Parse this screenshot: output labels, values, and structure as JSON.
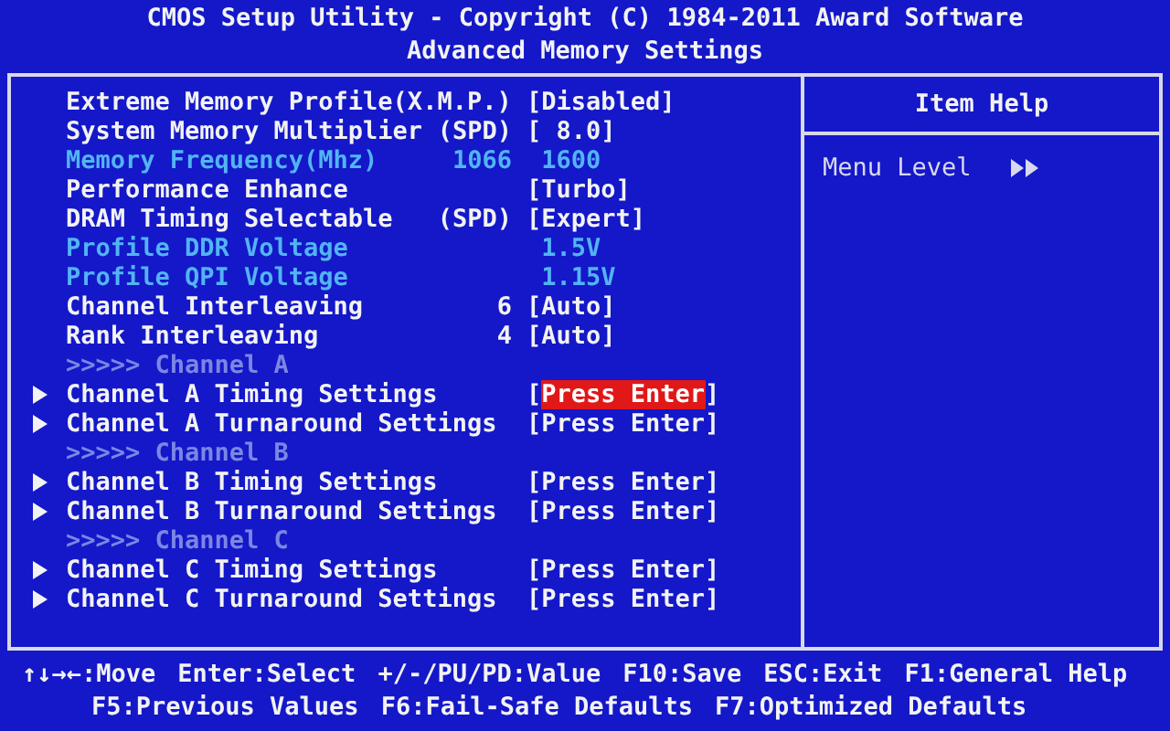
{
  "header": {
    "title": "CMOS Setup Utility - Copyright (C) 1984-2011 Award Software",
    "subtitle": "Advanced Memory Settings"
  },
  "items": [
    {
      "kind": "setting",
      "label": "Extreme Memory Profile(X.M.P.)",
      "value": "[Disabled]",
      "disabled": false,
      "selected": false
    },
    {
      "kind": "setting",
      "label": "System Memory Multiplier",
      "mid": "(SPD)",
      "value": "[ 8.0]",
      "disabled": false,
      "selected": false
    },
    {
      "kind": "setting",
      "label": "Memory Frequency(Mhz)",
      "mid": "1066",
      "value": " 1600",
      "disabled": true,
      "selected": false
    },
    {
      "kind": "setting",
      "label": "Performance Enhance",
      "value": "[Turbo]",
      "disabled": false,
      "selected": false
    },
    {
      "kind": "setting",
      "label": "DRAM Timing Selectable",
      "mid": "(SPD)",
      "value": "[Expert]",
      "disabled": false,
      "selected": false
    },
    {
      "kind": "setting",
      "label": "Profile DDR Voltage",
      "value": " 1.5V",
      "disabled": true,
      "selected": false
    },
    {
      "kind": "setting",
      "label": "Profile QPI Voltage",
      "value": " 1.15V",
      "disabled": true,
      "selected": false
    },
    {
      "kind": "setting",
      "label": "Channel Interleaving",
      "mid": "6",
      "value": "[Auto]",
      "disabled": false,
      "selected": false
    },
    {
      "kind": "setting",
      "label": "Rank Interleaving",
      "mid": "4",
      "value": "[Auto]",
      "disabled": false,
      "selected": false
    },
    {
      "kind": "header",
      "label": ">>>>> Channel A"
    },
    {
      "kind": "submenu",
      "label": "Channel A Timing Settings",
      "value": "[Press Enter]",
      "selected": true
    },
    {
      "kind": "submenu",
      "label": "Channel A Turnaround Settings",
      "value": "[Press Enter]",
      "selected": false
    },
    {
      "kind": "header",
      "label": ">>>>> Channel B"
    },
    {
      "kind": "submenu",
      "label": "Channel B Timing Settings",
      "value": "[Press Enter]",
      "selected": false
    },
    {
      "kind": "submenu",
      "label": "Channel B Turnaround Settings",
      "value": "[Press Enter]",
      "selected": false
    },
    {
      "kind": "header",
      "label": ">>>>> Channel C"
    },
    {
      "kind": "submenu",
      "label": "Channel C Timing Settings",
      "value": "[Press Enter]",
      "selected": false
    },
    {
      "kind": "submenu",
      "label": "Channel C Turnaround Settings",
      "value": "[Press Enter]",
      "selected": false
    }
  ],
  "help": {
    "title": "Item Help",
    "menu_level": "Menu Level"
  },
  "footer": [
    [
      "↑↓→←:Move",
      "Enter:Select",
      "+/-/PU/PD:Value",
      "F10:Save",
      "ESC:Exit",
      "F1:General Help"
    ],
    [
      "F5:Previous Values",
      "F6:Fail-Safe Defaults",
      "F7:Optimized Defaults"
    ]
  ]
}
